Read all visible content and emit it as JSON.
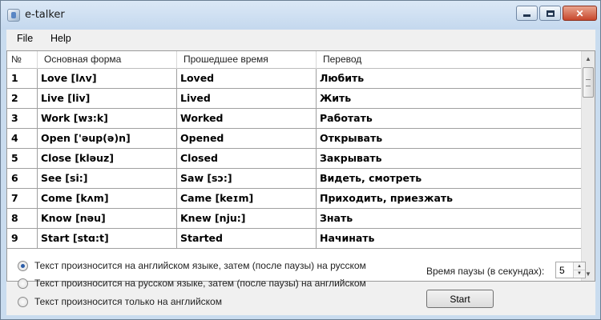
{
  "window": {
    "title": "e-talker"
  },
  "menu": {
    "file": "File",
    "help": "Help"
  },
  "table": {
    "headers": [
      "№",
      "Основная форма",
      "Прошедшее время",
      "Перевод"
    ],
    "rows": [
      [
        "1",
        "Love [lʌv]",
        "Loved",
        "Любить"
      ],
      [
        "2",
        "Live [liv]",
        "Lived",
        "Жить"
      ],
      [
        "3",
        "Work [wɜ:k]",
        "Worked",
        "Работать"
      ],
      [
        "4",
        "Open ['əup(ə)n]",
        "Opened",
        "Открывать"
      ],
      [
        "5",
        "Close [kləuz]",
        "Closed",
        "Закрывать"
      ],
      [
        "6",
        "See [si:]",
        "Saw [sɔ:]",
        "Видеть, смотреть"
      ],
      [
        "7",
        "Come [kʌm]",
        "Came [keɪm]",
        "Приходить, приезжать"
      ],
      [
        "8",
        "Know [nəu]",
        "Knew [nju:]",
        "Знать"
      ],
      [
        "9",
        "Start [stɑ:t]",
        "Started",
        "Начинать"
      ]
    ]
  },
  "options": {
    "radios": [
      {
        "label": "Текст произносится на английском языке, затем (после паузы) на русском",
        "checked": true
      },
      {
        "label": "Текст произносится на русском языке, затем (после паузы) на английском",
        "checked": false
      },
      {
        "label": "Текст произносится только на английском",
        "checked": false
      }
    ],
    "pause_label": "Время паузы (в секундах):",
    "pause_value": "5",
    "start_label": "Start"
  },
  "icons": {
    "app": "app-icon",
    "minimize": "minimize-icon",
    "maximize": "maximize-icon",
    "close": "close-icon",
    "scroll_up": "scroll-up-icon",
    "scroll_down": "scroll-down-icon"
  }
}
